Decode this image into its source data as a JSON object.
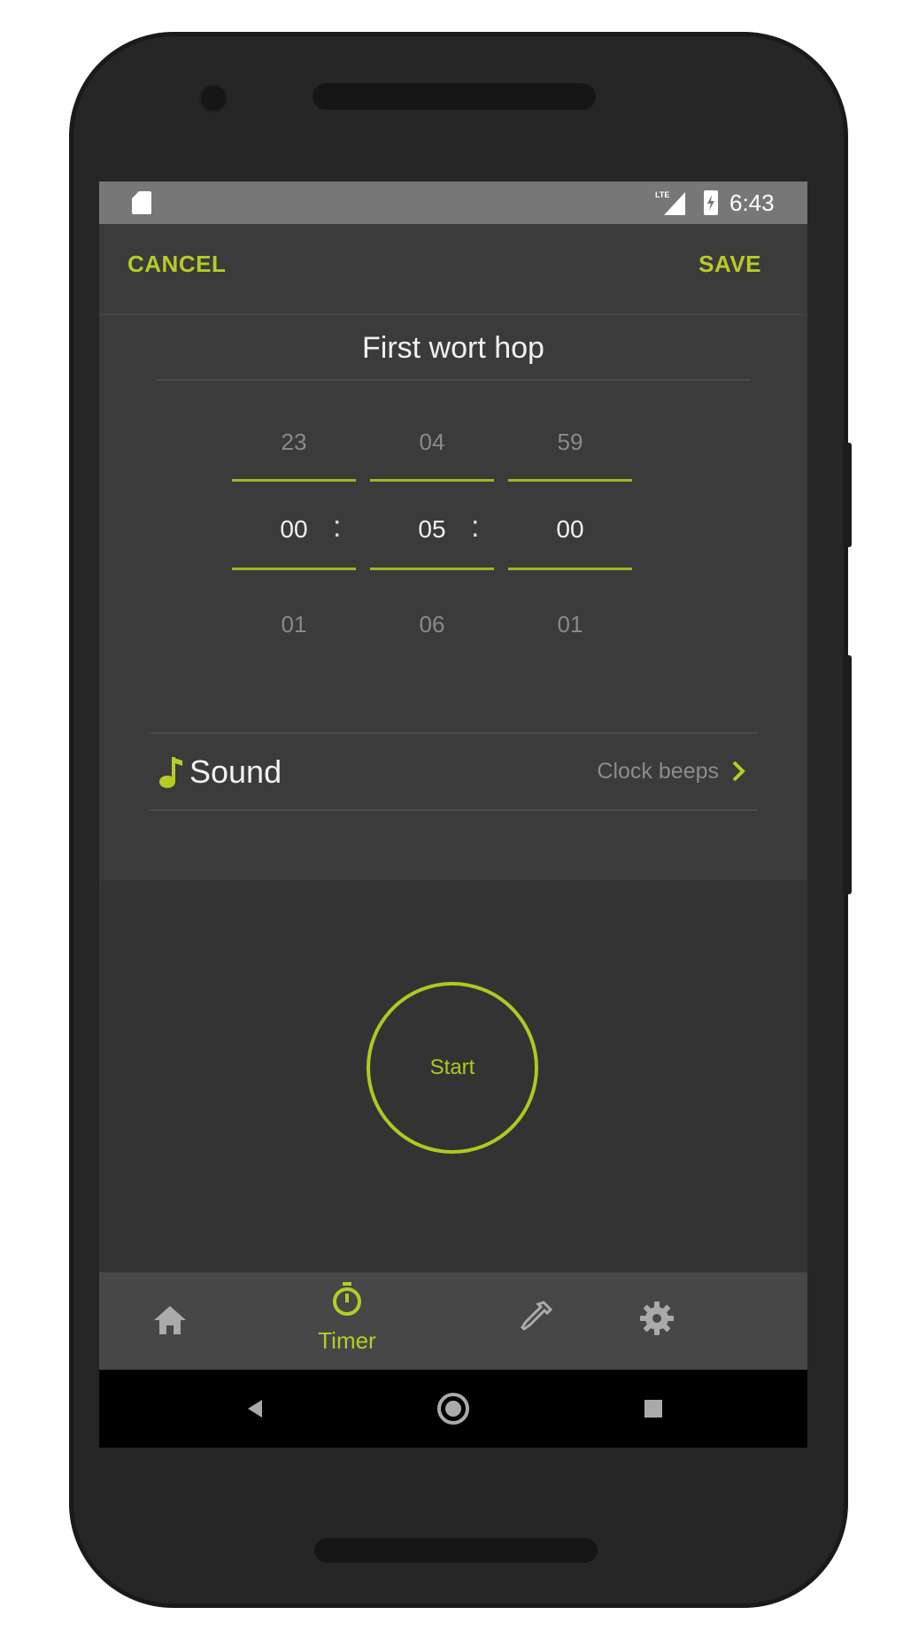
{
  "status_bar": {
    "network": "LTE",
    "time": "6:43"
  },
  "toolbar": {
    "cancel_label": "CANCEL",
    "save_label": "SAVE"
  },
  "timer": {
    "title": "First wort hop",
    "hours": {
      "above": "23",
      "selected": "00",
      "below": "01"
    },
    "minutes": {
      "above": "04",
      "selected": "05",
      "below": "06"
    },
    "seconds": {
      "above": "59",
      "selected": "00",
      "below": "01"
    },
    "separator": ":"
  },
  "sound": {
    "label": "Sound",
    "value": "Clock beeps"
  },
  "start_label": "Start",
  "bottom_nav": {
    "items": [
      {
        "id": "home",
        "icon": "home-icon",
        "label": "",
        "active": false
      },
      {
        "id": "timer",
        "icon": "stopwatch-icon",
        "label": "Timer",
        "active": true
      },
      {
        "id": "hydrometer",
        "icon": "pipette-icon",
        "label": "",
        "active": false
      },
      {
        "id": "settings",
        "icon": "gear-icon",
        "label": "",
        "active": false
      }
    ]
  },
  "colors": {
    "accent": "#b5cc26",
    "background": "#333333",
    "panel": "#3b3b3b",
    "statusbar": "#777777",
    "navbar": "#474747"
  }
}
